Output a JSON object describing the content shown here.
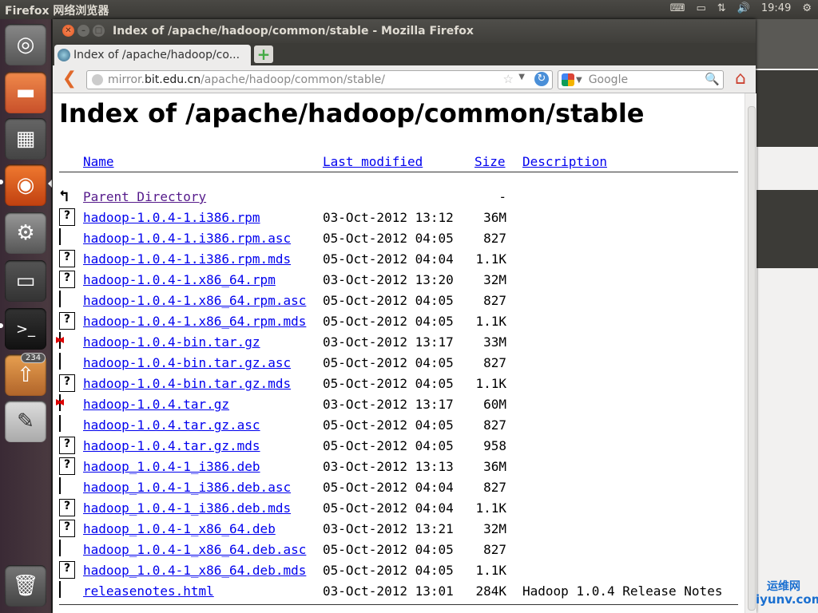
{
  "topbar": {
    "app_name": "Firefox 网络浏览器",
    "time": "19:49"
  },
  "launcher": {
    "badge_count": "234"
  },
  "window": {
    "title": "Index of /apache/hadoop/common/stable - Mozilla Firefox"
  },
  "tab": {
    "label": "Index of /apache/hadoop/co..."
  },
  "navbar": {
    "url_prefix": "mirror.",
    "url_host": "bit.edu.cn",
    "url_path": "/apache/hadoop/common/stable/",
    "search_placeholder": "Google"
  },
  "page": {
    "heading": "Index of /apache/hadoop/common/stable",
    "columns": {
      "name": "Name",
      "modified": "Last modified",
      "size": "Size",
      "description": "Description"
    },
    "parent": {
      "label": "Parent Directory",
      "size": "-"
    },
    "files": [
      {
        "name": "hadoop-1.0.4-1.i386.rpm",
        "modified": "03-Oct-2012 13:12",
        "size": "36M",
        "desc": "",
        "icon": "unknown"
      },
      {
        "name": "hadoop-1.0.4-1.i386.rpm.asc",
        "modified": "05-Oct-2012 04:05",
        "size": "827",
        "desc": "",
        "icon": "text"
      },
      {
        "name": "hadoop-1.0.4-1.i386.rpm.mds",
        "modified": "05-Oct-2012 04:04",
        "size": "1.1K",
        "desc": "",
        "icon": "unknown"
      },
      {
        "name": "hadoop-1.0.4-1.x86_64.rpm",
        "modified": "03-Oct-2012 13:20",
        "size": "32M",
        "desc": "",
        "icon": "unknown"
      },
      {
        "name": "hadoop-1.0.4-1.x86_64.rpm.asc",
        "modified": "05-Oct-2012 04:05",
        "size": "827",
        "desc": "",
        "icon": "text"
      },
      {
        "name": "hadoop-1.0.4-1.x86_64.rpm.mds",
        "modified": "05-Oct-2012 04:05",
        "size": "1.1K",
        "desc": "",
        "icon": "unknown"
      },
      {
        "name": "hadoop-1.0.4-bin.tar.gz",
        "modified": "03-Oct-2012 13:17",
        "size": "33M",
        "desc": "",
        "icon": "compressed"
      },
      {
        "name": "hadoop-1.0.4-bin.tar.gz.asc",
        "modified": "05-Oct-2012 04:05",
        "size": "827",
        "desc": "",
        "icon": "text"
      },
      {
        "name": "hadoop-1.0.4-bin.tar.gz.mds",
        "modified": "05-Oct-2012 04:05",
        "size": "1.1K",
        "desc": "",
        "icon": "unknown"
      },
      {
        "name": "hadoop-1.0.4.tar.gz",
        "modified": "03-Oct-2012 13:17",
        "size": "60M",
        "desc": "",
        "icon": "compressed"
      },
      {
        "name": "hadoop-1.0.4.tar.gz.asc",
        "modified": "05-Oct-2012 04:05",
        "size": "827",
        "desc": "",
        "icon": "text"
      },
      {
        "name": "hadoop-1.0.4.tar.gz.mds",
        "modified": "05-Oct-2012 04:05",
        "size": "958",
        "desc": "",
        "icon": "unknown"
      },
      {
        "name": "hadoop_1.0.4-1_i386.deb",
        "modified": "03-Oct-2012 13:13",
        "size": "36M",
        "desc": "",
        "icon": "unknown"
      },
      {
        "name": "hadoop_1.0.4-1_i386.deb.asc",
        "modified": "05-Oct-2012 04:04",
        "size": "827",
        "desc": "",
        "icon": "text"
      },
      {
        "name": "hadoop_1.0.4-1_i386.deb.mds",
        "modified": "05-Oct-2012 04:04",
        "size": "1.1K",
        "desc": "",
        "icon": "unknown"
      },
      {
        "name": "hadoop_1.0.4-1_x86_64.deb",
        "modified": "03-Oct-2012 13:21",
        "size": "32M",
        "desc": "",
        "icon": "unknown"
      },
      {
        "name": "hadoop_1.0.4-1_x86_64.deb.asc",
        "modified": "05-Oct-2012 04:05",
        "size": "827",
        "desc": "",
        "icon": "text"
      },
      {
        "name": "hadoop_1.0.4-1_x86_64.deb.mds",
        "modified": "05-Oct-2012 04:05",
        "size": "1.1K",
        "desc": "",
        "icon": "unknown"
      },
      {
        "name": "releasenotes.html",
        "modified": "03-Oct-2012 13:01",
        "size": "284K",
        "desc": "Hadoop 1.0.4 Release Notes",
        "icon": "text"
      }
    ]
  },
  "watermark": {
    "line1": "运维网",
    "line2": "iyunv.com"
  }
}
